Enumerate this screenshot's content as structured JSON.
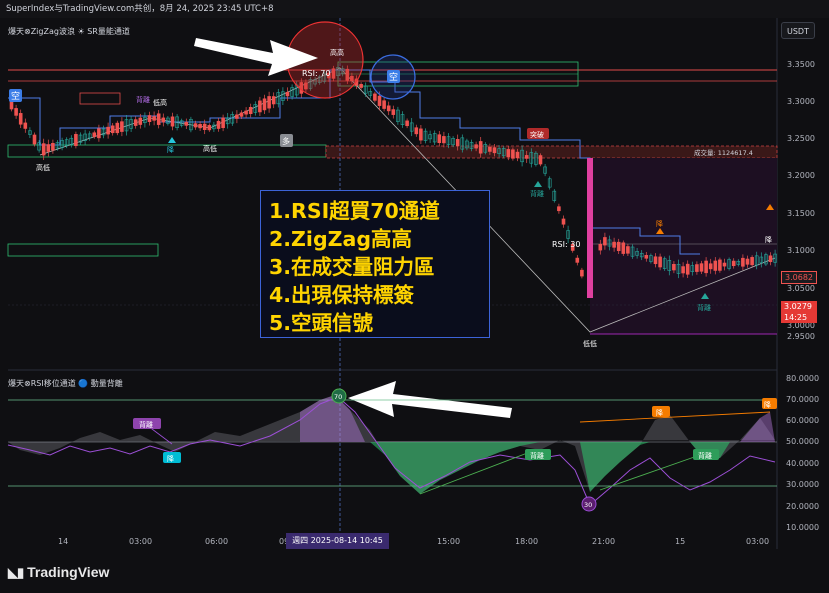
{
  "topbar": {
    "text": "SuperIndex与TradingView.com共创，8月 24, 2025 23:45 UTC+8"
  },
  "currency_button": "USDT",
  "main_pane": {
    "legend": "爆天⊗ZigZag波浪 ☀ SR量能通道",
    "price_axis": [
      "3.3500",
      "3.3000",
      "3.2500",
      "3.2000",
      "3.1500",
      "3.1000",
      "3.0500",
      "3.0000",
      "2.9500"
    ],
    "current_price": "3.0682",
    "last_price": "3.0279",
    "countdown": "14:25",
    "labels": {
      "high_high": "高高",
      "rsi70": "RSI: 70",
      "rsi30": "RSI: 30",
      "short": "空",
      "divergence_left": "背離",
      "low_high": "低高",
      "low_low": "高低",
      "low_low2": "高低",
      "down": "降",
      "long": "多",
      "breakout": "突破",
      "div_bottom": "背離",
      "bottom_low": "低低",
      "down2": "降",
      "divergence_right": "背離",
      "drop_right": "降",
      "volume": "成交量: 1124617.4"
    }
  },
  "callout": {
    "lines": [
      "1.RSI超買70通道",
      "2.ZigZag高高",
      "3.在成交量阻力區",
      "4.出現保持標簽",
      "5.空頭信號"
    ],
    "color": "#ffd400"
  },
  "rsi_pane": {
    "legend": "爆天⊗RSI移位通道 🔵 動量背離",
    "axis": [
      "80.0000",
      "70.0000",
      "60.0000",
      "50.0000",
      "40.0000",
      "30.0000",
      "20.0000",
      "10.0000"
    ],
    "labels": {
      "div1": "背離",
      "down1": "降",
      "rsi70": "70",
      "div2": "背離",
      "down2": "降",
      "rsi30": "30",
      "div3": "背離",
      "down3": "降"
    }
  },
  "time_axis": [
    "14",
    "03:00",
    "06:00",
    "09:00",
    "15:00",
    "18:00",
    "21:00",
    "15",
    "03:00"
  ],
  "crosshair_time": "週四 2025-08-14  10:45",
  "brand": "TradingView",
  "colors": {
    "up": "#26a69a",
    "down": "#ef5350",
    "accent": "#3c63d8",
    "purple": "#7e57c2"
  }
}
